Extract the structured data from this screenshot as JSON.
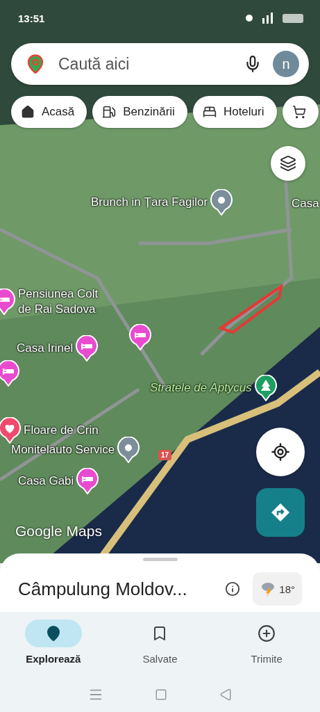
{
  "status_bar": {
    "time": "13:51"
  },
  "search": {
    "placeholder": "Caută aici",
    "avatar": "n"
  },
  "chips": [
    {
      "kind": "home",
      "label": "Acasă"
    },
    {
      "kind": "fuel",
      "label": "Benzinării"
    },
    {
      "kind": "hotel",
      "label": "Hoteluri"
    },
    {
      "kind": "shop"
    }
  ],
  "places": [
    {
      "kind": "generic",
      "label": "Brunch in Țara Fagilor"
    },
    {
      "kind": "text",
      "label": "Casa"
    },
    {
      "kind": "hotel",
      "label": "Pensiunea Colt de Rai Sadova"
    },
    {
      "kind": "hotel",
      "label": "Casa Irinel"
    },
    {
      "kind": "hotel"
    },
    {
      "kind": "hotel"
    },
    {
      "kind": "park",
      "label": "Stratele de Aptycus"
    },
    {
      "kind": "favorite",
      "label": "Floare de Crin"
    },
    {
      "kind": "generic",
      "label": "Monitelauto Service"
    },
    {
      "kind": "hotel",
      "label": "Casa Gabi"
    }
  ],
  "road_shield": "17",
  "map_logo": "Google Maps",
  "sheet": {
    "title": "Câmpulung Moldov...",
    "temperature": "18°"
  },
  "nav": [
    {
      "kind": "explore",
      "label": "Explorează",
      "selected": true
    },
    {
      "kind": "saved",
      "label": "Salvate",
      "selected": false
    },
    {
      "kind": "contribute",
      "label": "Trimite",
      "selected": false
    }
  ]
}
